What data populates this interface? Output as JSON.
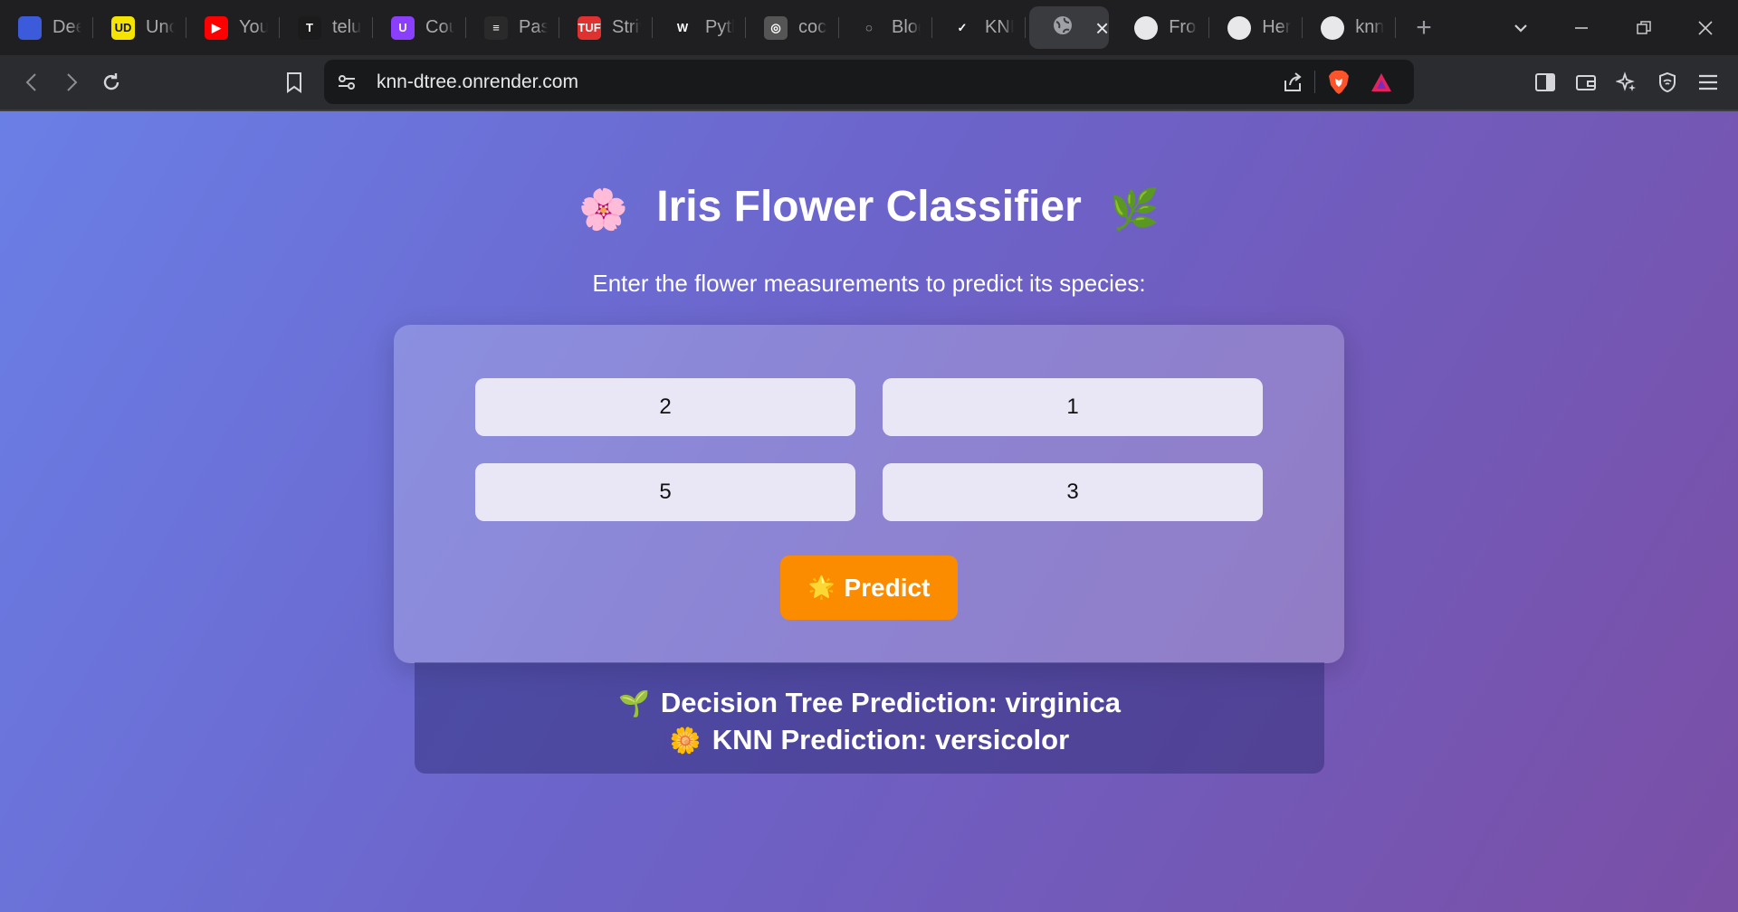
{
  "tabs": [
    {
      "title": "Dee",
      "fav_color": "#3b5bdb",
      "fav_text": "",
      "icon": "deepseek-icon"
    },
    {
      "title": "Unc",
      "fav_color": "#f4e400",
      "fav_text": "UD",
      "icon": "udemy-icon"
    },
    {
      "title": "You",
      "fav_color": "#ff0000",
      "fav_text": "▶",
      "icon": "youtube-icon"
    },
    {
      "title": "telu",
      "fav_color": "#1b1b1b",
      "fav_text": "T",
      "icon": "telusko-icon"
    },
    {
      "title": "Cou",
      "fav_color": "#8a3ffc",
      "fav_text": "U",
      "icon": "course-icon"
    },
    {
      "title": "Pas",
      "fav_color": "#2a2a2a",
      "fav_text": "≡",
      "icon": "pasclub-icon"
    },
    {
      "title": "Striv",
      "fav_color": "#e03131",
      "fav_text": "TUF",
      "icon": "takeuforward-icon"
    },
    {
      "title": "Pytl",
      "fav_color": "#1f1f22",
      "fav_text": "W",
      "icon": "w3schools-icon"
    },
    {
      "title": "coc",
      "fav_color": "#555",
      "fav_text": "◎",
      "icon": "coco-icon"
    },
    {
      "title": "Blog",
      "fav_color": "#1f1f22",
      "fav_text": "◌",
      "icon": "blog-icon"
    },
    {
      "title": "KNI",
      "fav_color": "#1f1f22",
      "fav_text": "✓",
      "icon": "knn-tab-icon"
    }
  ],
  "active_tab": {
    "icon": "globe-icon"
  },
  "tabs_after": [
    {
      "title": "Fro",
      "icon": "openai-icon"
    },
    {
      "title": "Her",
      "icon": "github-icon"
    },
    {
      "title": "knn",
      "icon": "globe-icon"
    }
  ],
  "toolbar": {
    "url": "knn-dtree.onrender.com"
  },
  "page": {
    "title": "Iris Flower Classifier",
    "title_emoji_left": "🌸",
    "title_emoji_right": "🌿",
    "subtitle": "Enter the flower measurements to predict its species:",
    "inputs": [
      "2",
      "1",
      "5",
      "3"
    ],
    "predict_emoji": "🌟",
    "predict_label": "Predict",
    "result": {
      "dt_emoji": "🌱",
      "dt_text": "Decision Tree Prediction: virginica",
      "knn_emoji": "🌼",
      "knn_text": "KNN Prediction: versicolor"
    }
  }
}
